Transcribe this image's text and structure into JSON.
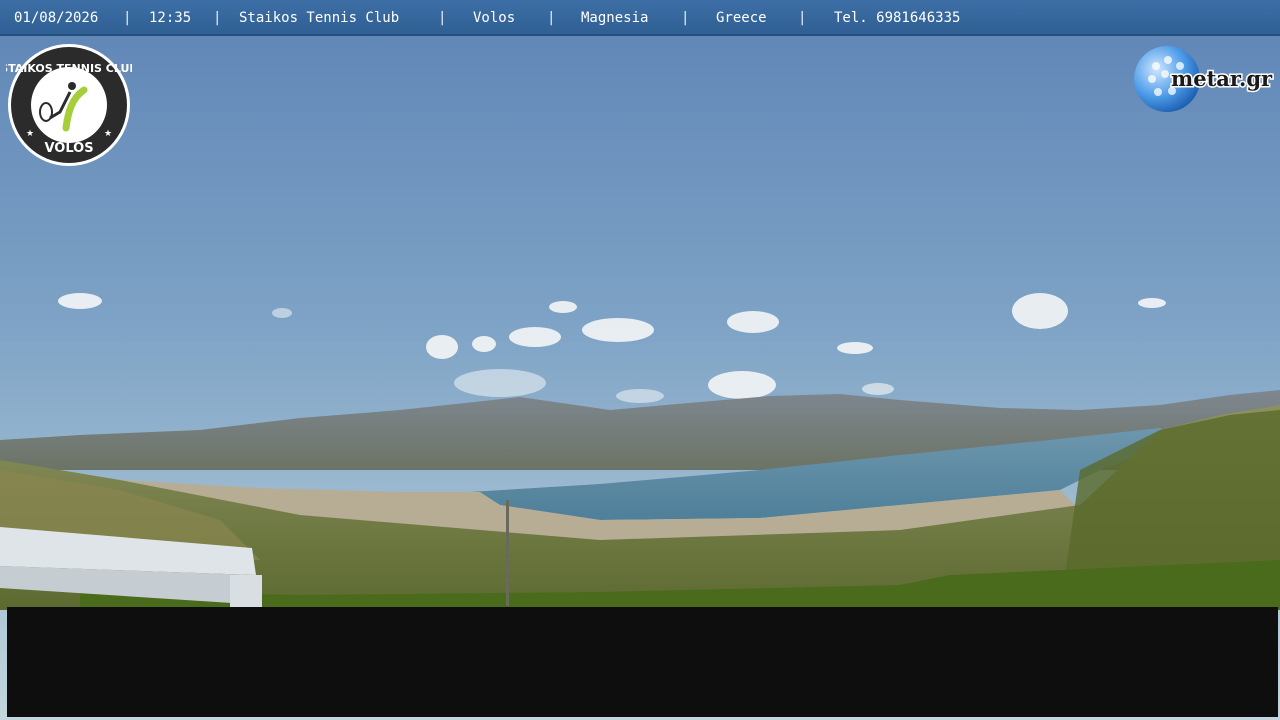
{
  "header": {
    "date": "01/08/2026",
    "time": "12:35",
    "club": "Staikos Tennis Club",
    "city": "Volos",
    "region": "Magnesia",
    "country": "Greece",
    "phone": "Tel. 6981646335",
    "separator": "|"
  },
  "logos": {
    "club_logo_text": "STAIKOS TENNIS CLUB VOLOS",
    "metar_text": "metar.gr"
  },
  "colors": {
    "bar_blue": "#3d6fa6",
    "sky_top": "#5f86b8",
    "sea": "#5d8aa2",
    "black_panel": "#0e0e0e"
  }
}
